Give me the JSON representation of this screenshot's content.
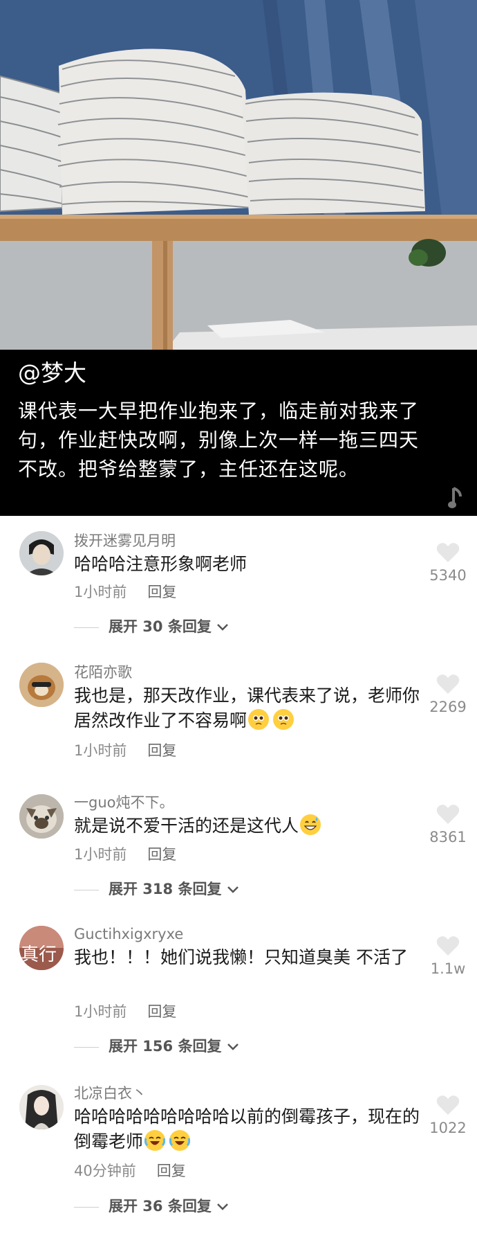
{
  "caption": {
    "author": "@梦大",
    "text": "课代表一大早把作业抱来了，临走前对我来了句，作业赶快改啊，别像上次一样一拖三四天不改。把爷给整蒙了，主任还在这呢。"
  },
  "comments": [
    {
      "username": "拨开迷雾见月明",
      "text": "哈哈哈注意形象啊老师",
      "time": "1小时前",
      "reply_label": "回复",
      "likes": "5340",
      "expand": "展开 30 条回复",
      "emojis": []
    },
    {
      "username": "花陌亦歌",
      "text": "我也是，那天改作业，课代表来了说，老师你居然改作业了不容易啊",
      "time": "1小时前",
      "reply_label": "回复",
      "likes": "2269",
      "expand": "",
      "emojis": [
        "pleading-face-emoji",
        "pleading-face-emoji"
      ]
    },
    {
      "username": "一guo炖不下。",
      "text": "就是说不爱干活的还是这代人",
      "time": "1小时前",
      "reply_label": "回复",
      "likes": "8361",
      "expand": "展开 318 条回复",
      "emojis": [
        "grinning-sweat-emoji"
      ]
    },
    {
      "username": "Guctihxigxryxe",
      "text": "我也！！！她们说我懒！只知道臭美 不活了",
      "time": "1小时前",
      "reply_label": "回复",
      "likes": "1.1w",
      "expand": "展开 156 条回复",
      "emojis": []
    },
    {
      "username": "北凉白衣丶",
      "text": "哈哈哈哈哈哈哈哈哈以前的倒霉孩子，现在的倒霉老师",
      "time": "40分钟前",
      "reply_label": "回复",
      "likes": "1022",
      "expand": "展开 36 条回复",
      "emojis": [
        "crying-laughing-emoji",
        "crying-laughing-emoji"
      ]
    }
  ],
  "avatar_partial_text": "真行"
}
